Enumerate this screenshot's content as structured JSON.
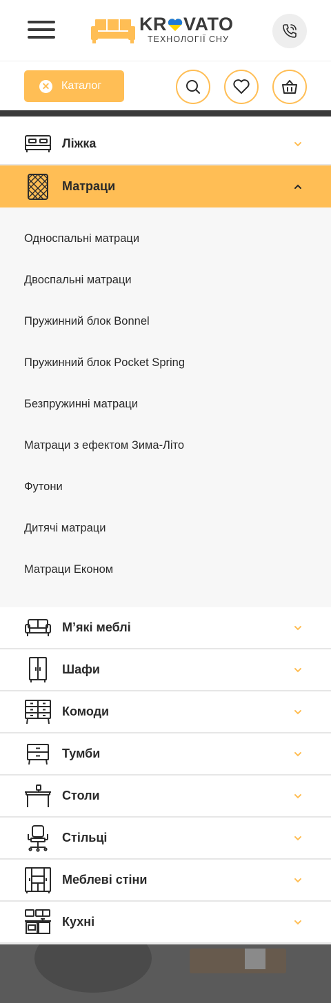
{
  "header": {
    "logo": {
      "word_left": "KR",
      "word_right": "VATO",
      "tagline": "ТЕХНОЛОГІЇ СНУ"
    },
    "icons": {
      "menu": "hamburger-icon",
      "phone": "phone-icon"
    }
  },
  "toolbar": {
    "catalog_label": "Каталог",
    "icons": {
      "close": "close-icon",
      "search": "search-icon",
      "wishlist": "heart-icon",
      "cart": "basket-icon"
    }
  },
  "colors": {
    "accent": "#ffbe55",
    "dark": "#3a3a3a",
    "submenu_bg": "#f7f7f7",
    "divider": "#e6e6e6"
  },
  "menu": {
    "categories": [
      {
        "label": "Ліжка",
        "icon": "bed-icon",
        "expanded": false
      },
      {
        "label": "Матраци",
        "icon": "mattress-icon",
        "expanded": true
      },
      {
        "label": "М’які меблі",
        "icon": "sofa-icon",
        "expanded": false
      },
      {
        "label": "Шафи",
        "icon": "wardrobe-icon",
        "expanded": false
      },
      {
        "label": "Комоди",
        "icon": "dresser-icon",
        "expanded": false
      },
      {
        "label": "Тумби",
        "icon": "nightstand-icon",
        "expanded": false
      },
      {
        "label": "Столи",
        "icon": "table-icon",
        "expanded": false
      },
      {
        "label": "Стільці",
        "icon": "office-chair-icon",
        "expanded": false
      },
      {
        "label": "Меблеві стіни",
        "icon": "wall-unit-icon",
        "expanded": false
      },
      {
        "label": "Кухні",
        "icon": "kitchen-icon",
        "expanded": false
      }
    ],
    "mattress_subitems": [
      "Односпальні матраци",
      "Двоспальні матраци",
      "Пружинний блок Bonnel",
      "Пружинний блок Pocket Spring",
      "Безпружинні матраци",
      "Матраци з ефектом Зима-Літо",
      "Футони",
      "Дитячі матраци",
      "Матраци Економ"
    ]
  }
}
